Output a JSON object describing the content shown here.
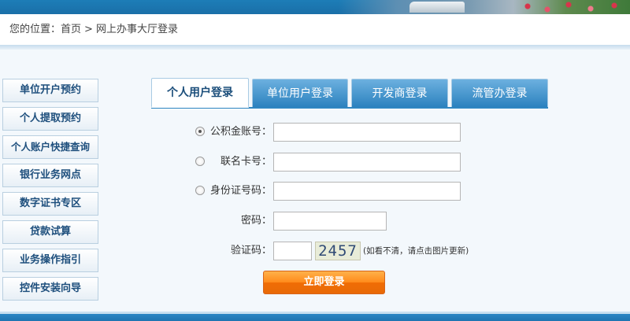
{
  "breadcrumb": {
    "prefix": "您的位置：",
    "home": "首页",
    "separator": ">",
    "current": "网上办事大厅登录"
  },
  "sidebar": {
    "items": [
      {
        "label": "单位开户预约"
      },
      {
        "label": "个人提取预约"
      },
      {
        "label": "个人账户快捷查询"
      },
      {
        "label": "银行业务网点"
      },
      {
        "label": "数字证书专区"
      },
      {
        "label": "贷款试算"
      },
      {
        "label": "业务操作指引"
      },
      {
        "label": "控件安装向导"
      }
    ]
  },
  "tabs": [
    {
      "label": "个人用户登录",
      "active": true
    },
    {
      "label": "单位用户登录",
      "active": false
    },
    {
      "label": "开发商登录",
      "active": false
    },
    {
      "label": "流管办登录",
      "active": false
    }
  ],
  "form": {
    "login_types": [
      {
        "label": "公积金账号：",
        "value": "",
        "selected": true
      },
      {
        "label": "联名卡号：",
        "value": "",
        "selected": false
      },
      {
        "label": "身份证号码：",
        "value": "",
        "selected": false
      }
    ],
    "password_label": "密码：",
    "password_value": "",
    "captcha_label": "验证码：",
    "captcha_value": "",
    "captcha_text": "2457",
    "captcha_hint": "(如看不清，请点击图片更新)",
    "submit_label": "立即登录"
  },
  "colors": {
    "tab_blue": "#2c82bf",
    "submit_orange": "#f07d0d",
    "nav_text": "#1e4f7d"
  }
}
